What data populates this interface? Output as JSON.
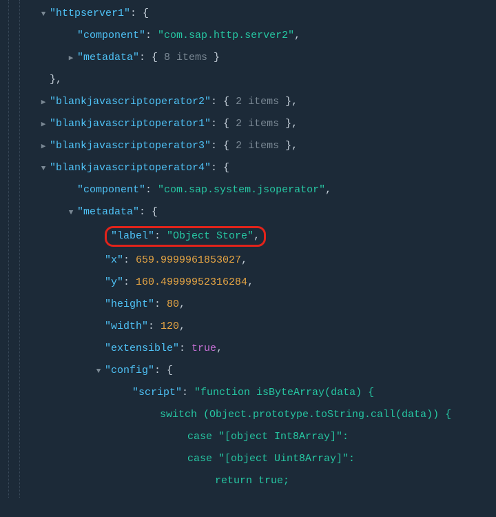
{
  "indentUnitPx": 40,
  "baseIndentPx": 8,
  "guideOffsets": [
    12,
    28
  ],
  "tree": [
    {
      "indent": 1,
      "toggle": "open",
      "parts": [
        [
          "key",
          "\"httpserver1\""
        ],
        [
          "punct",
          ": {"
        ]
      ]
    },
    {
      "indent": 2,
      "toggle": "none",
      "parts": [
        [
          "key",
          "\"component\""
        ],
        [
          "punct",
          ": "
        ],
        [
          "string",
          "\"com.sap.http.server2\""
        ],
        [
          "punct",
          ","
        ]
      ]
    },
    {
      "indent": 2,
      "toggle": "closed",
      "parts": [
        [
          "key",
          "\"metadata\""
        ],
        [
          "punct",
          ": {  "
        ],
        [
          "summary",
          "8 items"
        ],
        [
          "punct",
          "  }"
        ]
      ]
    },
    {
      "indent": 1,
      "toggle": "none",
      "parts": [
        [
          "punct",
          "},"
        ]
      ]
    },
    {
      "indent": 1,
      "toggle": "closed",
      "parts": [
        [
          "key",
          "\"blankjavascriptoperator2\""
        ],
        [
          "punct",
          ": {  "
        ],
        [
          "summary",
          "2 items"
        ],
        [
          "punct",
          "  },"
        ]
      ]
    },
    {
      "indent": 1,
      "toggle": "closed",
      "parts": [
        [
          "key",
          "\"blankjavascriptoperator1\""
        ],
        [
          "punct",
          ": {  "
        ],
        [
          "summary",
          "2 items"
        ],
        [
          "punct",
          "  },"
        ]
      ]
    },
    {
      "indent": 1,
      "toggle": "closed",
      "parts": [
        [
          "key",
          "\"blankjavascriptoperator3\""
        ],
        [
          "punct",
          ": {  "
        ],
        [
          "summary",
          "2 items"
        ],
        [
          "punct",
          "  },"
        ]
      ]
    },
    {
      "indent": 1,
      "toggle": "open",
      "parts": [
        [
          "key",
          "\"blankjavascriptoperator4\""
        ],
        [
          "punct",
          ": {"
        ]
      ]
    },
    {
      "indent": 2,
      "toggle": "none",
      "parts": [
        [
          "key",
          "\"component\""
        ],
        [
          "punct",
          ": "
        ],
        [
          "string",
          "\"com.sap.system.jsoperator\""
        ],
        [
          "punct",
          ","
        ]
      ]
    },
    {
      "indent": 2,
      "toggle": "open",
      "parts": [
        [
          "key",
          "\"metadata\""
        ],
        [
          "punct",
          ": {"
        ]
      ]
    },
    {
      "indent": 3,
      "toggle": "none",
      "highlight": true,
      "parts": [
        [
          "key",
          "\"label\""
        ],
        [
          "punct",
          ": "
        ],
        [
          "string",
          "\"Object Store\""
        ],
        [
          "punct",
          ","
        ]
      ]
    },
    {
      "indent": 3,
      "toggle": "none",
      "parts": [
        [
          "key",
          "\"x\""
        ],
        [
          "punct",
          ": "
        ],
        [
          "number",
          "659.9999961853027"
        ],
        [
          "punct",
          ","
        ]
      ]
    },
    {
      "indent": 3,
      "toggle": "none",
      "parts": [
        [
          "key",
          "\"y\""
        ],
        [
          "punct",
          ": "
        ],
        [
          "number",
          "160.49999952316284"
        ],
        [
          "punct",
          ","
        ]
      ]
    },
    {
      "indent": 3,
      "toggle": "none",
      "parts": [
        [
          "key",
          "\"height\""
        ],
        [
          "punct",
          ": "
        ],
        [
          "number",
          "80"
        ],
        [
          "punct",
          ","
        ]
      ]
    },
    {
      "indent": 3,
      "toggle": "none",
      "parts": [
        [
          "key",
          "\"width\""
        ],
        [
          "punct",
          ": "
        ],
        [
          "number",
          "120"
        ],
        [
          "punct",
          ","
        ]
      ]
    },
    {
      "indent": 3,
      "toggle": "none",
      "parts": [
        [
          "key",
          "\"extensible\""
        ],
        [
          "punct",
          ": "
        ],
        [
          "bool",
          "true"
        ],
        [
          "punct",
          ","
        ]
      ]
    },
    {
      "indent": 3,
      "toggle": "open",
      "parts": [
        [
          "key",
          "\"config\""
        ],
        [
          "punct",
          ": {"
        ]
      ]
    },
    {
      "indent": 4,
      "toggle": "none",
      "parts": [
        [
          "key",
          "\"script\""
        ],
        [
          "punct",
          ": "
        ],
        [
          "string",
          "\"function isByteArray(data) {"
        ]
      ]
    },
    {
      "indent": 5,
      "toggle": "none",
      "parts": [
        [
          "string",
          "switch (Object.prototype.toString.call(data)) {"
        ]
      ]
    },
    {
      "indent": 6,
      "toggle": "none",
      "parts": [
        [
          "string",
          "case \"[object Int8Array]\":"
        ]
      ]
    },
    {
      "indent": 6,
      "toggle": "none",
      "parts": [
        [
          "string",
          "case \"[object Uint8Array]\":"
        ]
      ]
    },
    {
      "indent": 7,
      "toggle": "none",
      "parts": [
        [
          "string",
          "return true;"
        ]
      ]
    }
  ]
}
